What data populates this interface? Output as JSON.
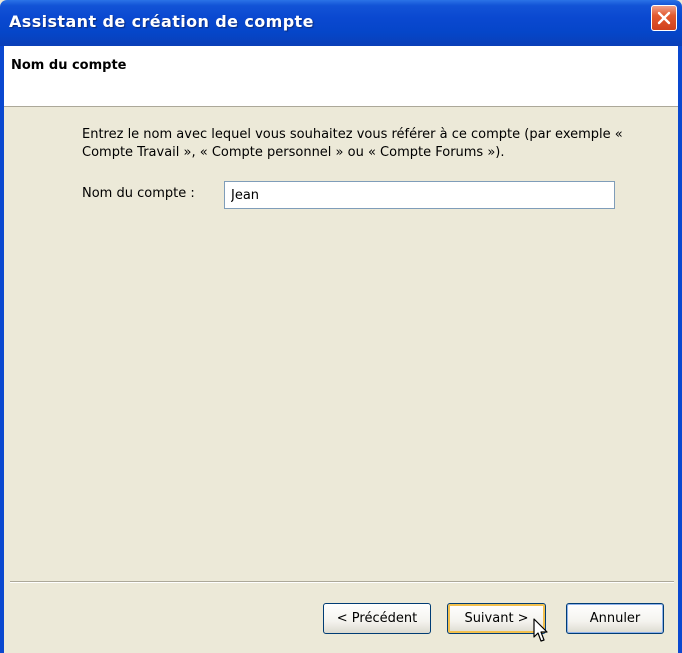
{
  "window": {
    "title": "Assistant de création de compte"
  },
  "header": {
    "title": "Nom du compte"
  },
  "content": {
    "description": "Entrez le nom avec lequel vous souhaitez vous référer à ce compte (par exemple « Compte Travail », « Compte personnel » ou « Compte Forums »).",
    "account_name_label": "Nom du compte :",
    "account_name_value": "Jean"
  },
  "buttons": {
    "previous": "< Précédent",
    "next": "Suivant >",
    "cancel": "Annuler"
  },
  "icons": {
    "close": "close-icon",
    "cursor": "mouse-pointer-icon"
  },
  "colors": {
    "titlebar": "#0a48d0",
    "close_button": "#e3592e",
    "dialog_background": "#ece9d8",
    "default_button_focus": "#f2c04e"
  }
}
